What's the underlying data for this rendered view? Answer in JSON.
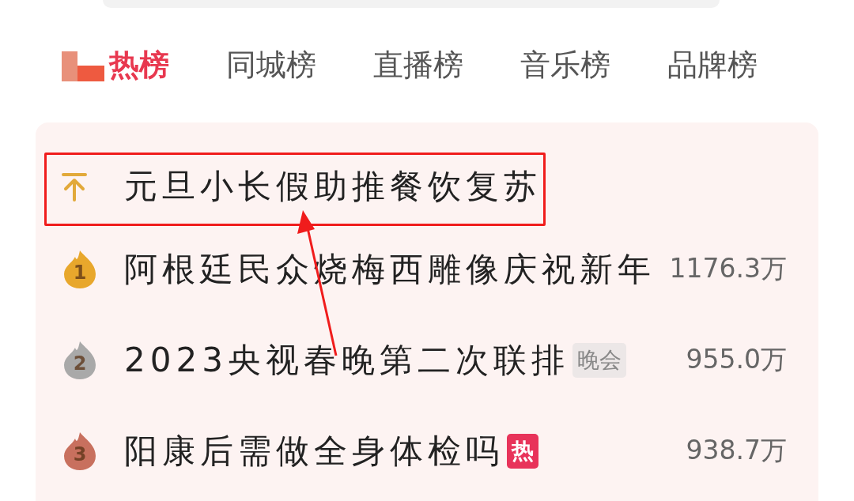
{
  "tabs": [
    {
      "label": "热榜",
      "selected": true
    },
    {
      "label": "同城榜",
      "selected": false
    },
    {
      "label": "直播榜",
      "selected": false
    },
    {
      "label": "音乐榜",
      "selected": false
    },
    {
      "label": "品牌榜",
      "selected": false
    }
  ],
  "list": [
    {
      "kind": "pinned",
      "title": "元旦小长假助推餐饮复苏",
      "highlighted": true
    },
    {
      "kind": "ranked",
      "rank": "1",
      "color": "#e8a72c",
      "title": "阿根廷民众烧梅西雕像庆祝新年",
      "value": "1176.3万"
    },
    {
      "kind": "ranked",
      "rank": "2",
      "color": "#a9a9a9",
      "title": "2023央视春晚第二次联排",
      "tag": {
        "kind": "label",
        "text": "晚会"
      },
      "value": "955.0万"
    },
    {
      "kind": "ranked",
      "rank": "3",
      "color": "#c8705e",
      "title": "阳康后需做全身体检吗",
      "tag": {
        "kind": "hot",
        "text": "热"
      },
      "value": "938.7万"
    }
  ]
}
